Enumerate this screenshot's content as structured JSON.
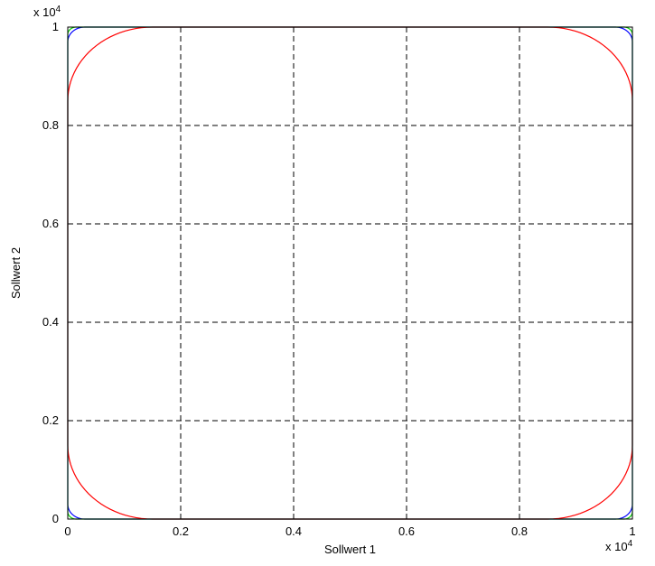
{
  "chart_data": {
    "type": "line",
    "title": "",
    "xlabel": "Sollwert 1",
    "ylabel": "Sollwert 2",
    "xlim": [
      0,
      10000
    ],
    "ylim": [
      0,
      10000
    ],
    "x_exponent_label": "x 10^4",
    "y_exponent_label": "x 10^4",
    "x_ticks": [
      0,
      2000,
      4000,
      6000,
      8000,
      10000
    ],
    "y_ticks": [
      0,
      2000,
      4000,
      6000,
      8000,
      10000
    ],
    "x_tick_labels": [
      "0",
      "0.2",
      "0.4",
      "0.6",
      "0.8",
      "1"
    ],
    "y_tick_labels": [
      "0",
      "0.2",
      "0.4",
      "0.6",
      "0.8",
      "1"
    ],
    "grid": true,
    "legend": false,
    "series": [
      {
        "name": "blue",
        "color": "#0000ff",
        "description": "small rounded square near each corner (radius ≈ 300)",
        "closed": true,
        "x": [
          0,
          300,
          9700,
          10000,
          10000,
          9700,
          300,
          0,
          0
        ],
        "y": [
          300,
          0,
          0,
          300,
          9700,
          10000,
          10000,
          9700,
          300
        ]
      },
      {
        "name": "green",
        "color": "#00cc00",
        "description": "rounded square hugging axis limits (small corner radius ≈ 150)",
        "closed": true,
        "x": [
          0,
          150,
          9850,
          10000,
          10000,
          9850,
          150,
          0,
          0
        ],
        "y": [
          150,
          0,
          0,
          150,
          9850,
          10000,
          10000,
          9850,
          150
        ]
      },
      {
        "name": "red",
        "color": "#ff0000",
        "description": "rounded square with large corner radius (≈ 1500)",
        "closed": true,
        "x": [
          0,
          1500,
          8500,
          10000,
          10000,
          8500,
          1500,
          0,
          0
        ],
        "y": [
          1500,
          0,
          0,
          1500,
          8500,
          10000,
          10000,
          8500,
          1500
        ]
      }
    ]
  }
}
